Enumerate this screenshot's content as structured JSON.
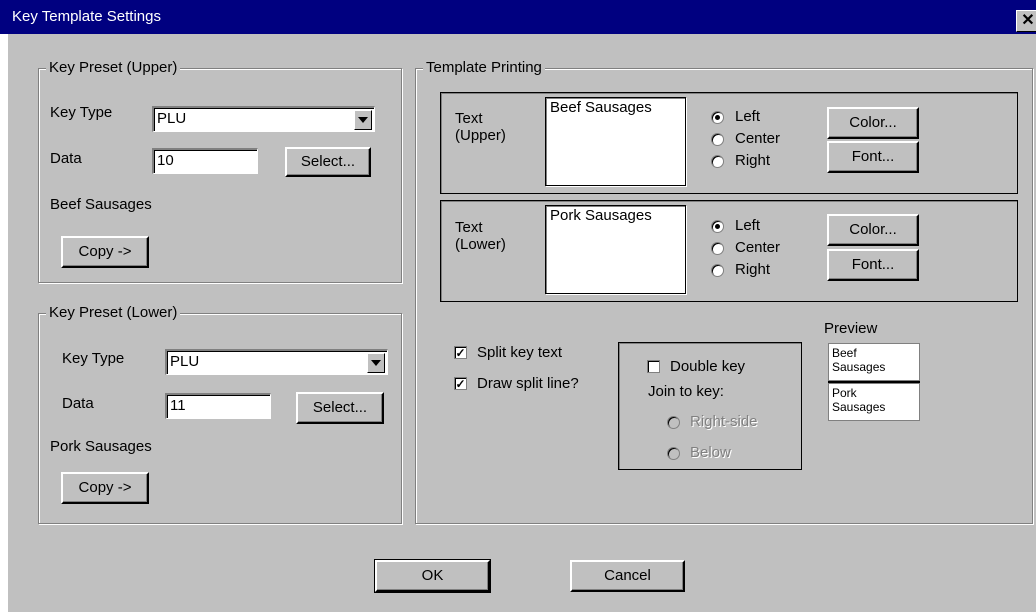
{
  "window": {
    "title": "Key Template Settings",
    "close_glyph": "✕"
  },
  "upper_preset": {
    "group_label": "Key Preset (Upper)",
    "key_type_label": "Key Type",
    "key_type_value": "PLU",
    "data_label": "Data",
    "data_value": "10",
    "select_label": "Select...",
    "item_name": "Beef Sausages",
    "copy_label": "Copy ->"
  },
  "lower_preset": {
    "group_label": "Key Preset (Lower)",
    "key_type_label": "Key Type",
    "key_type_value": "PLU",
    "data_label": "Data",
    "data_value": "11",
    "select_label": "Select...",
    "item_name": "Pork Sausages",
    "copy_label": "Copy ->"
  },
  "template_printing": {
    "group_label": "Template Printing",
    "upper": {
      "label_line1": "Text",
      "label_line2": "(Upper)",
      "text": "Beef Sausages",
      "align_options": [
        "Left",
        "Center",
        "Right"
      ],
      "align_selected": "Left",
      "color_label": "Color...",
      "font_label": "Font..."
    },
    "lower": {
      "label_line1": "Text",
      "label_line2": "(Lower)",
      "text": "Pork Sausages",
      "align_options": [
        "Left",
        "Center",
        "Right"
      ],
      "align_selected": "Left",
      "color_label": "Color...",
      "font_label": "Font..."
    },
    "split_key_text": {
      "label": "Split key text",
      "checked": true
    },
    "draw_split_line": {
      "label": "Draw split line?",
      "checked": true
    },
    "double_key": {
      "label": "Double key",
      "checked": false,
      "join_label": "Join to key:",
      "join_options": [
        "Right-side",
        "Below"
      ],
      "join_enabled": false
    },
    "preview": {
      "label": "Preview",
      "upper_line1": "Beef",
      "upper_line2": "Sausages",
      "lower_line1": "Pork",
      "lower_line2": "Sausages"
    }
  },
  "footer": {
    "ok_label": "OK",
    "cancel_label": "Cancel"
  },
  "colors": {
    "title_bar": "#000080",
    "dialog_bg": "#c0c0c0",
    "title_text": "#ffffff"
  }
}
